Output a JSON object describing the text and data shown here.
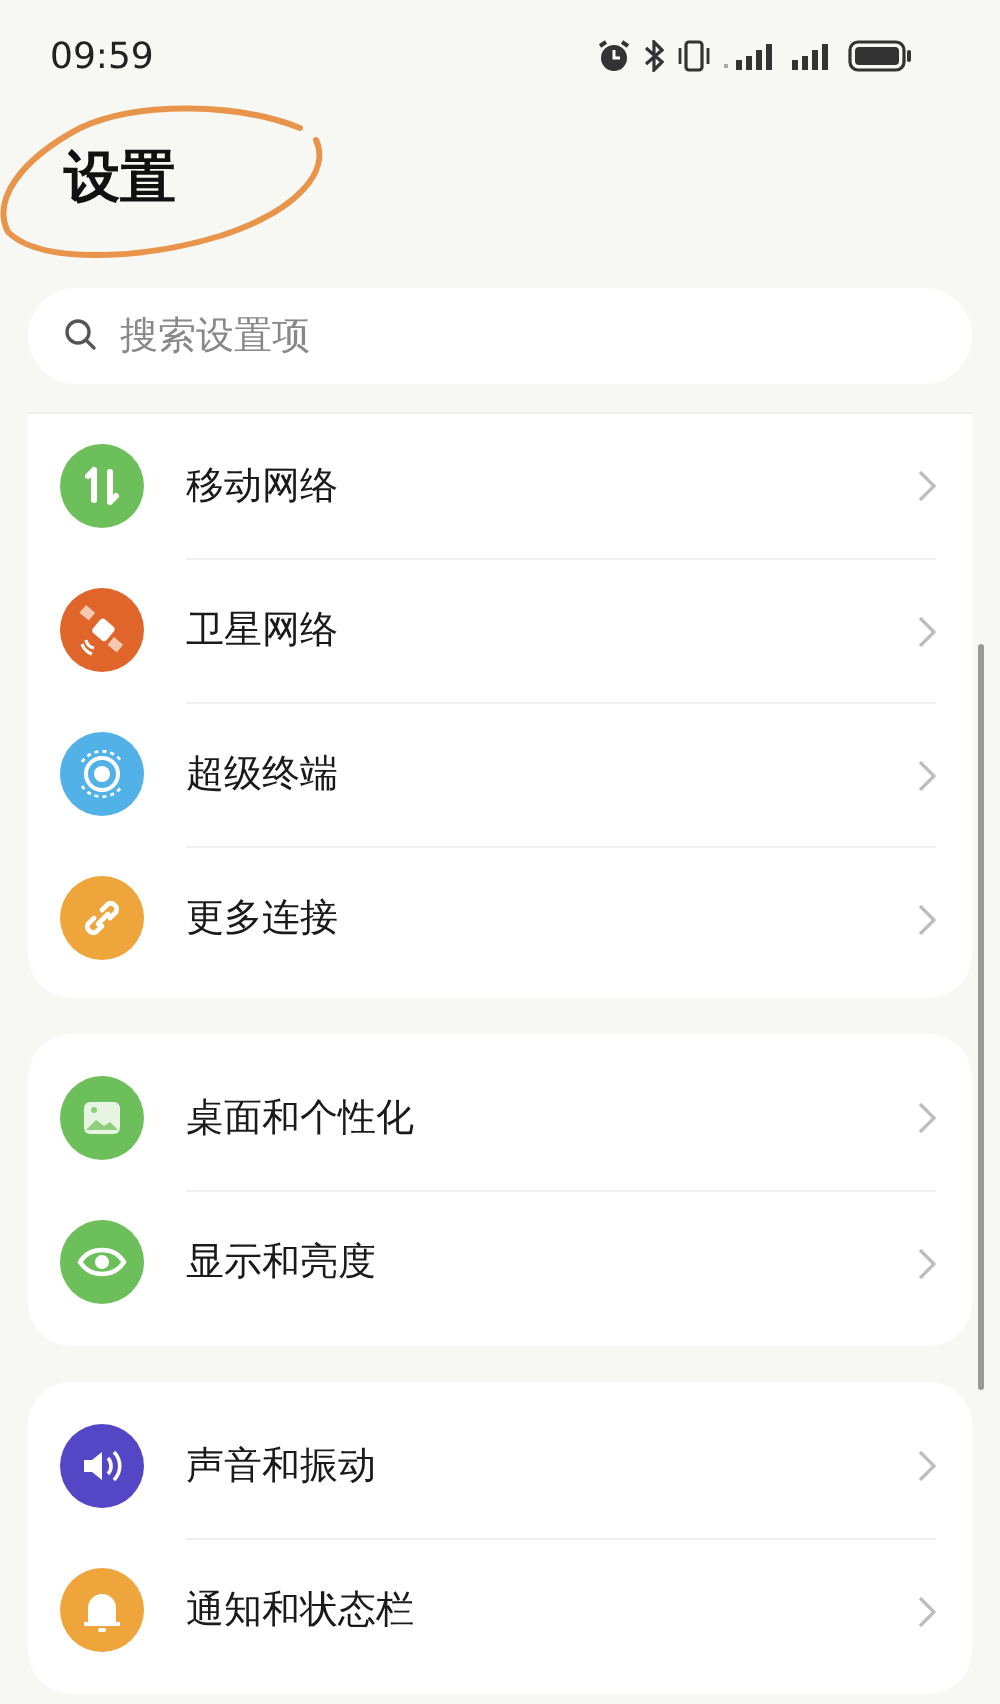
{
  "status_bar": {
    "time": "09:59"
  },
  "title": "设置",
  "search": {
    "placeholder": "搜索设置项"
  },
  "groups": [
    {
      "items": [
        {
          "label": "移动网络",
          "color": "#6cbf5a"
        },
        {
          "label": "卫星网络",
          "color": "#e0652a"
        },
        {
          "label": "超级终端",
          "color": "#52b1e6"
        },
        {
          "label": "更多连接",
          "color": "#eea53b"
        }
      ]
    },
    {
      "items": [
        {
          "label": "桌面和个性化",
          "color": "#6cbf5a"
        },
        {
          "label": "显示和亮度",
          "color": "#6cbf5a"
        }
      ]
    },
    {
      "items": [
        {
          "label": "声音和振动",
          "color": "#5546c6"
        },
        {
          "label": "通知和状态栏",
          "color": "#eea53b"
        }
      ]
    }
  ]
}
